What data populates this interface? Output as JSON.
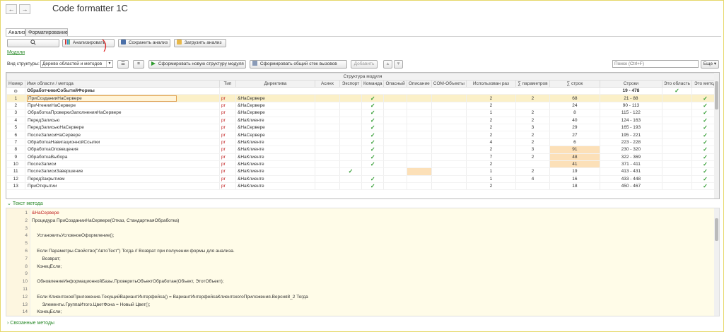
{
  "window": {
    "title": "Code formatter 1C"
  },
  "nav": {
    "back": "←",
    "forward": "→"
  },
  "tabs": [
    {
      "label": "Анализ"
    },
    {
      "label": "Форматирование"
    }
  ],
  "toolbar": {
    "analyze_label": "Анализировать",
    "save_label": "Сохранить анализ",
    "load_label": "Загрузить анализ"
  },
  "modules_link": "Модули",
  "structure": {
    "view_label": "Вид структуры:",
    "view_value": "Дерево областей и методов",
    "build_label": "Сформировать новую структуру модуля",
    "stack_label": "Сформировать общий стек вызовов",
    "add_label": "Добавить",
    "search_placeholder": "Поиск (Ctrl+F)",
    "more_label": "Еще"
  },
  "grid": {
    "group_header": "Структура модуля",
    "columns": [
      "Номер",
      "Имя области / метода",
      "Тип",
      "Директива",
      "Асинх",
      "Экспорт",
      "Команда",
      "Опасный",
      "Описание",
      "COM-Объекты",
      "Использован раз",
      "∑ параметров",
      "∑ строк",
      "Строки",
      "Это область",
      "Это метод"
    ],
    "group_row": {
      "name": "ОбработчикиСобытийФормы",
      "lines": "19 - 478"
    },
    "rows": [
      {
        "num": "1",
        "name": "ПриСозданииНаСервере",
        "type": "pr",
        "dir": "&НаСервере",
        "cmd": true,
        "used": "2",
        "params": "2",
        "count": "68",
        "lines": "21 - 88"
      },
      {
        "num": "2",
        "name": "ПриЧтенииНаСервере",
        "type": "pr",
        "dir": "&НаСервере",
        "cmd": true,
        "used": "2",
        "params": "",
        "count": "24",
        "lines": "90 - 113"
      },
      {
        "num": "3",
        "name": "ОбработкаПроверкиЗаполненияНаСервере",
        "type": "pr",
        "dir": "&НаСервере",
        "cmd": true,
        "used": "1",
        "params": "2",
        "count": "8",
        "lines": "115 - 122"
      },
      {
        "num": "4",
        "name": "ПередЗаписью",
        "type": "pr",
        "dir": "&НаКлиенте",
        "cmd": true,
        "used": "2",
        "params": "2",
        "count": "40",
        "lines": "124 - 163"
      },
      {
        "num": "5",
        "name": "ПередЗаписьюНаСервере",
        "type": "pr",
        "dir": "&НаСервере",
        "cmd": true,
        "used": "2",
        "params": "3",
        "count": "29",
        "lines": "165 - 193"
      },
      {
        "num": "6",
        "name": "ПослеЗаписиНаСервере",
        "type": "pr",
        "dir": "&НаСервере",
        "cmd": true,
        "used": "2",
        "params": "2",
        "count": "27",
        "lines": "195 - 221"
      },
      {
        "num": "7",
        "name": "ОбработкаНавигационнойСсылки",
        "type": "pr",
        "dir": "&НаКлиенте",
        "cmd": true,
        "used": "4",
        "params": "2",
        "count": "6",
        "lines": "223 - 228"
      },
      {
        "num": "8",
        "name": "ОбработкаОповещения",
        "type": "pr",
        "dir": "&НаКлиенте",
        "cmd": true,
        "used": "2",
        "params": "3",
        "count": "91",
        "lines": "230 - 320"
      },
      {
        "num": "9",
        "name": "ОбработкаВыбора",
        "type": "pr",
        "dir": "&НаКлиенте",
        "cmd": true,
        "used": "7",
        "params": "2",
        "count": "48",
        "lines": "322 - 369"
      },
      {
        "num": "10",
        "name": "ПослеЗаписи",
        "type": "pr",
        "dir": "&НаКлиенте",
        "cmd": true,
        "used": "2",
        "params": "",
        "count": "41",
        "lines": "371 - 411"
      },
      {
        "num": "11",
        "name": "ПослеЗаписиЗавершение",
        "type": "pr",
        "dir": "&НаКлиенте",
        "cmd": false,
        "export": true,
        "used": "1",
        "params": "2",
        "count": "19",
        "lines": "413 - 431"
      },
      {
        "num": "12",
        "name": "ПередЗакрытием",
        "type": "pr",
        "dir": "&НаКлиенте",
        "cmd": true,
        "used": "1",
        "params": "4",
        "count": "16",
        "lines": "433 - 448"
      },
      {
        "num": "13",
        "name": "ПриОткрытии",
        "type": "pr",
        "dir": "&НаКлиенте",
        "cmd": true,
        "used": "2",
        "params": "",
        "count": "18",
        "lines": "450 - 467"
      }
    ]
  },
  "method_text": {
    "label": "Текст метода",
    "lines": [
      {
        "n": "1",
        "t": "&НаСервере"
      },
      {
        "n": "2",
        "t": "Процедура ПриСозданииНаСервере(Отказ, СтандартнаяОбработка)"
      },
      {
        "n": "3",
        "t": ""
      },
      {
        "n": "4",
        "t": "    УстановитьУсловноеОформление();"
      },
      {
        "n": "5",
        "t": ""
      },
      {
        "n": "6",
        "t": "    Если Параметры.Свойство(\"АвтоТест\") Тогда // Возврат при получении формы для анализа."
      },
      {
        "n": "7",
        "t": "        Возврат;"
      },
      {
        "n": "8",
        "t": "    КонецЕсли;"
      },
      {
        "n": "9",
        "t": ""
      },
      {
        "n": "10",
        "t": "    ОбновлениеИнформационнойБазы.ПроверитьОбъектОбработан(Объект, ЭтотОбъект);"
      },
      {
        "n": "11",
        "t": ""
      },
      {
        "n": "12",
        "t": "    Если КлиентскоеПриложение.ТекущийВариантИнтерфейса() = ВариантИнтерфейсаКлиентскогоПриложения.Версия8_2 Тогда"
      },
      {
        "n": "13",
        "t": "        Элементы.ГруппаИтого.ЦветФона = Новый Цвет();"
      },
      {
        "n": "14",
        "t": "    КонецЕсли;"
      }
    ]
  },
  "related_label": "Связанные методы",
  "colors": {
    "accent_green": "#2b8a2b",
    "selected_row": "#fbf0c8",
    "highlight_cell": "#fce0b8",
    "code_bg": "#fffce8"
  }
}
